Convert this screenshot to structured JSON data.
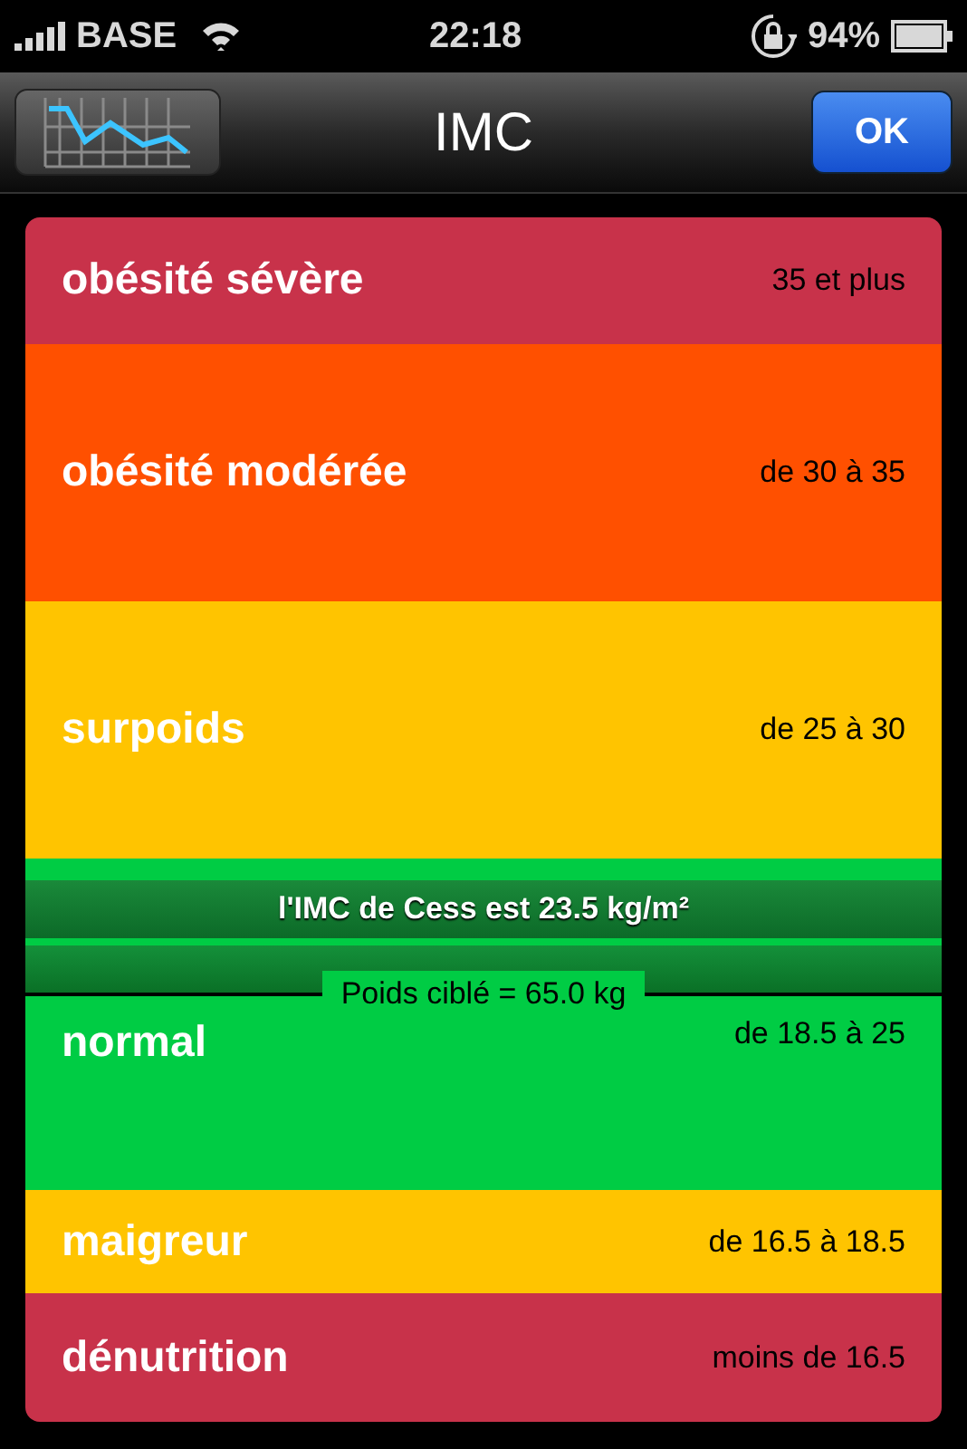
{
  "status_bar": {
    "carrier": "BASE",
    "time": "22:18",
    "battery": "94%"
  },
  "nav": {
    "title": "IMC",
    "ok": "OK"
  },
  "bands": [
    {
      "label": "obésité sévère",
      "range": "35 et plus",
      "color": "#c8324a"
    },
    {
      "label": "obésité modérée",
      "range": "de 30 à 35",
      "color": "#ff5000"
    },
    {
      "label": "surpoids",
      "range": "de 25 à 30",
      "color": "#ffc400"
    },
    {
      "label": "normal",
      "range": "de 18.5 à 25",
      "color": "#00cc44",
      "current": true
    },
    {
      "label": "maigreur",
      "range": "de 16.5 à 18.5",
      "color": "#ffc400"
    },
    {
      "label": "dénutrition",
      "range": "moins de 16.5",
      "color": "#c8324a"
    }
  ],
  "result": "l'IMC de Cess est 23.5 kg/m²",
  "target": "Poids ciblé = 65.0 kg"
}
